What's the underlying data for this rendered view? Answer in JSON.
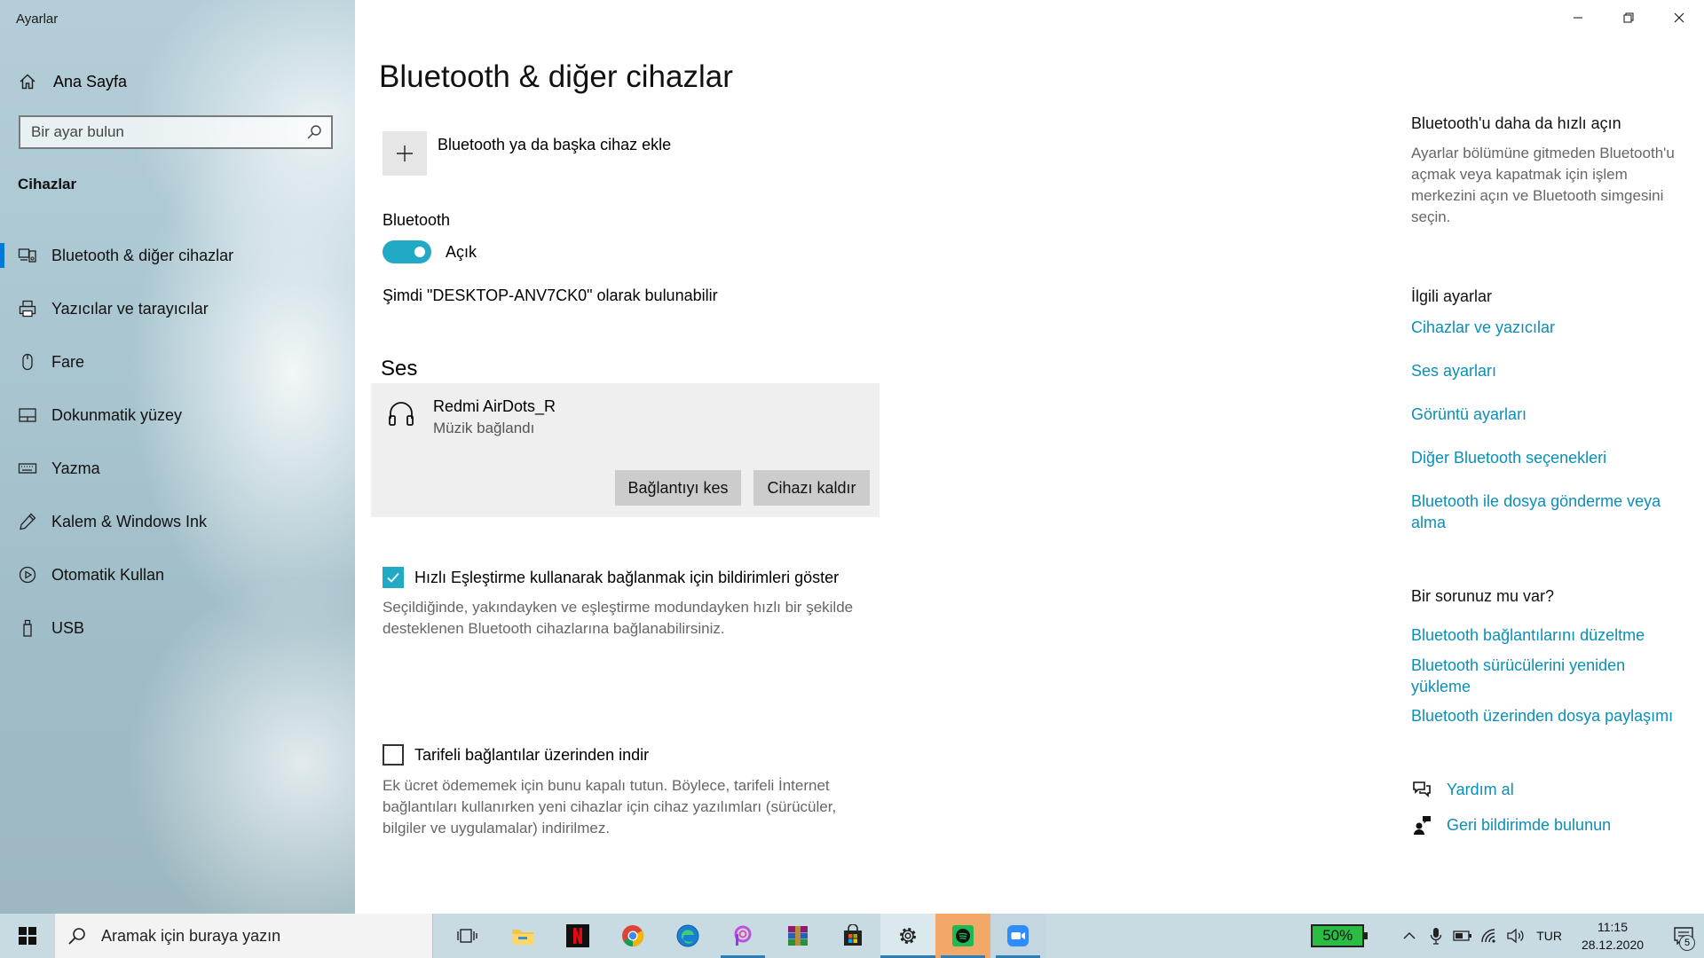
{
  "app": {
    "title": "Ayarlar"
  },
  "sidebar": {
    "home_label": "Ana Sayfa",
    "search_placeholder": "Bir ayar bulun",
    "section_title": "Cihazlar",
    "items": [
      {
        "label": "Bluetooth & diğer cihazlar",
        "icon": "bluetooth-devices-icon",
        "active": true
      },
      {
        "label": "Yazıcılar ve tarayıcılar",
        "icon": "printer-icon"
      },
      {
        "label": "Fare",
        "icon": "mouse-icon"
      },
      {
        "label": "Dokunmatik yüzey",
        "icon": "touchpad-icon"
      },
      {
        "label": "Yazma",
        "icon": "keyboard-icon"
      },
      {
        "label": "Kalem & Windows Ink",
        "icon": "pen-icon"
      },
      {
        "label": "Otomatik Kullan",
        "icon": "autoplay-icon"
      },
      {
        "label": "USB",
        "icon": "usb-icon"
      }
    ]
  },
  "main": {
    "title": "Bluetooth & diğer cihazlar",
    "add_device_label": "Bluetooth ya da başka cihaz ekle",
    "bluetooth_label": "Bluetooth",
    "bluetooth_state": "Açık",
    "discoverable_text": "Şimdi \"DESKTOP-ANV7CK0\" olarak bulunabilir",
    "audio_section": "Ses",
    "device": {
      "name": "Redmi AirDots_R",
      "status": "Müzik bağlandı",
      "disconnect_label": "Bağlantıyı kes",
      "remove_label": "Cihazı kaldır"
    },
    "swift_pair": {
      "checked": true,
      "label": "Hızlı Eşleştirme kullanarak bağlanmak için bildirimleri göster",
      "description": "Seçildiğinde, yakındayken ve eşleştirme modundayken hızlı bir şekilde desteklenen Bluetooth cihazlarına bağlanabilirsiniz."
    },
    "metered": {
      "checked": false,
      "label": "Tarifeli bağlantılar üzerinden indir",
      "description": "Ek ücret ödememek için bunu kapalı tutun. Böylece, tarifeli İnternet bağlantıları kullanırken yeni cihazlar için cihaz yazılımları (sürücüler, bilgiler ve uygulamalar) indirilmez."
    }
  },
  "right": {
    "quick_title": "Bluetooth'u daha da hızlı açın",
    "quick_text": "Ayarlar bölümüne gitmeden Bluetooth'u açmak veya kapatmak için işlem merkezini açın ve Bluetooth simgesini seçin.",
    "related_title": "İlgili ayarlar",
    "related_links": [
      "Cihazlar ve yazıcılar",
      "Ses ayarları",
      "Görüntü ayarları",
      "Diğer Bluetooth seçenekleri",
      "Bluetooth ile dosya gönderme veya alma"
    ],
    "question_title": "Bir sorunuz mu var?",
    "question_links": [
      "Bluetooth bağlantılarını düzeltme",
      "Bluetooth sürücülerini yeniden yükleme",
      "Bluetooth üzerinden dosya paylaşımı"
    ],
    "help_label": "Yardım al",
    "feedback_label": "Geri bildirimde bulunun"
  },
  "taskbar": {
    "search_text": "Aramak için buraya yazın",
    "apps": [
      "task-view-icon",
      "file-explorer-icon",
      "netflix-icon",
      "chrome-icon",
      "edge-icon",
      "picsart-icon",
      "winrar-icon",
      "store-icon",
      "settings-icon",
      "spotify-icon",
      "zoom-icon"
    ],
    "battery_percent": "50%",
    "language": "TUR",
    "time": "11:15",
    "date": "28.12.2020",
    "notification_count": "5"
  },
  "colors": {
    "accent": "#22a9c6",
    "link": "#0a8fb8",
    "battery": "#2bbd43",
    "spotify": "#1db954",
    "zoom": "#2d8cff"
  }
}
